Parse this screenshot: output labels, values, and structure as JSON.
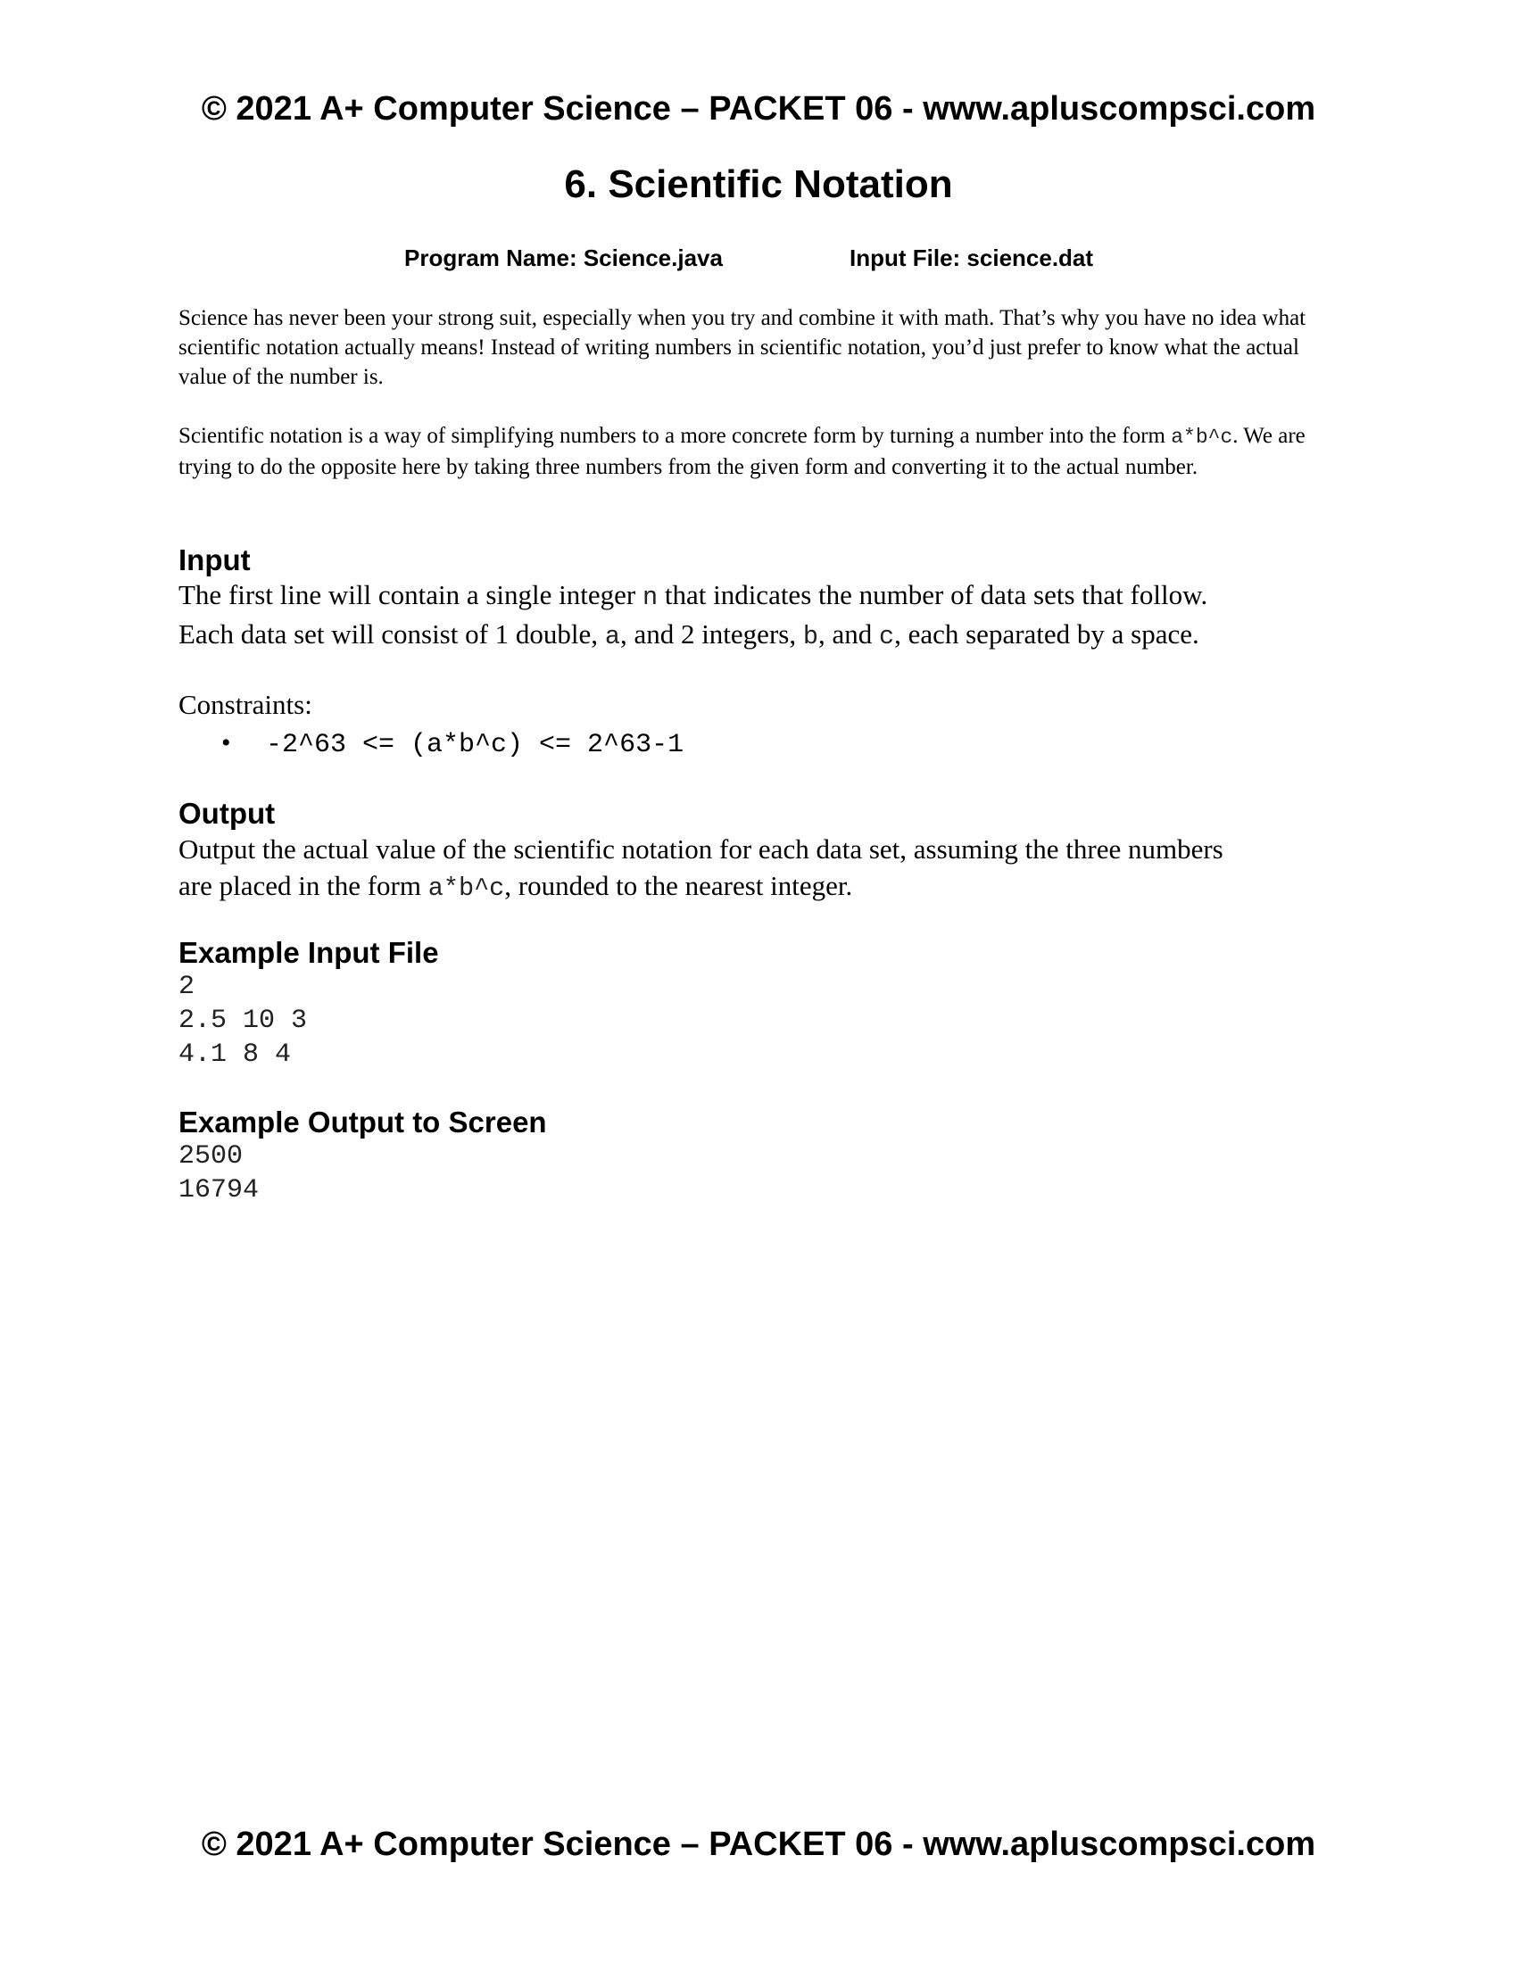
{
  "header": {
    "text": "© 2021 A+ Computer Science – PACKET 06 - www.apluscompsci.com"
  },
  "title": "6. Scientific Notation",
  "meta": {
    "program_name": "Program Name: Science.java",
    "input_file": "Input File: science.dat"
  },
  "intro": {
    "paragraph1": "Science has never been your strong suit, especially when you try and combine it with math. That’s why you have no idea what scientific notation actually means! Instead of writing numbers in scientific notation, you’d just prefer to know what the actual value of the number is.",
    "paragraph2_before": "Scientific notation is a way of simplifying numbers to a more concrete form by turning a number into the form ",
    "paragraph2_code": "a*b^c",
    "paragraph2_after": ". We are trying to do the opposite here by taking three numbers from the given form and converting it to the actual number."
  },
  "input_section": {
    "heading": "Input",
    "line1_before": "The first line will contain a single integer ",
    "line1_code": "n",
    "line1_after": " that indicates the number of data sets that follow.",
    "line2_part1": "Each data set will consist of 1 double, ",
    "line2_code_a": "a",
    "line2_part2": ", and 2 integers, ",
    "line2_code_b": "b",
    "line2_part3": ", and ",
    "line2_code_c": "c",
    "line2_part4": ", each separated by a space.",
    "constraints_label": "Constraints:",
    "bullet": "•",
    "constraints": [
      "-2^63 <= (a*b^c) <= 2^63-1"
    ]
  },
  "output_section": {
    "heading": "Output",
    "line1": "Output the actual value of the scientific notation for each data set, assuming the three numbers",
    "line2_before": "are placed in the form ",
    "line2_code": "a*b^c",
    "line2_after": ",  rounded to the nearest integer."
  },
  "example_input": {
    "heading": "Example Input File",
    "lines": [
      "2",
      "2.5 10 3",
      "4.1 8 4"
    ]
  },
  "example_output": {
    "heading": "Example Output to Screen",
    "lines": [
      "2500",
      "16794"
    ]
  },
  "footer": {
    "text": "© 2021 A+ Computer Science – PACKET 06 - www.apluscompsci.com"
  }
}
